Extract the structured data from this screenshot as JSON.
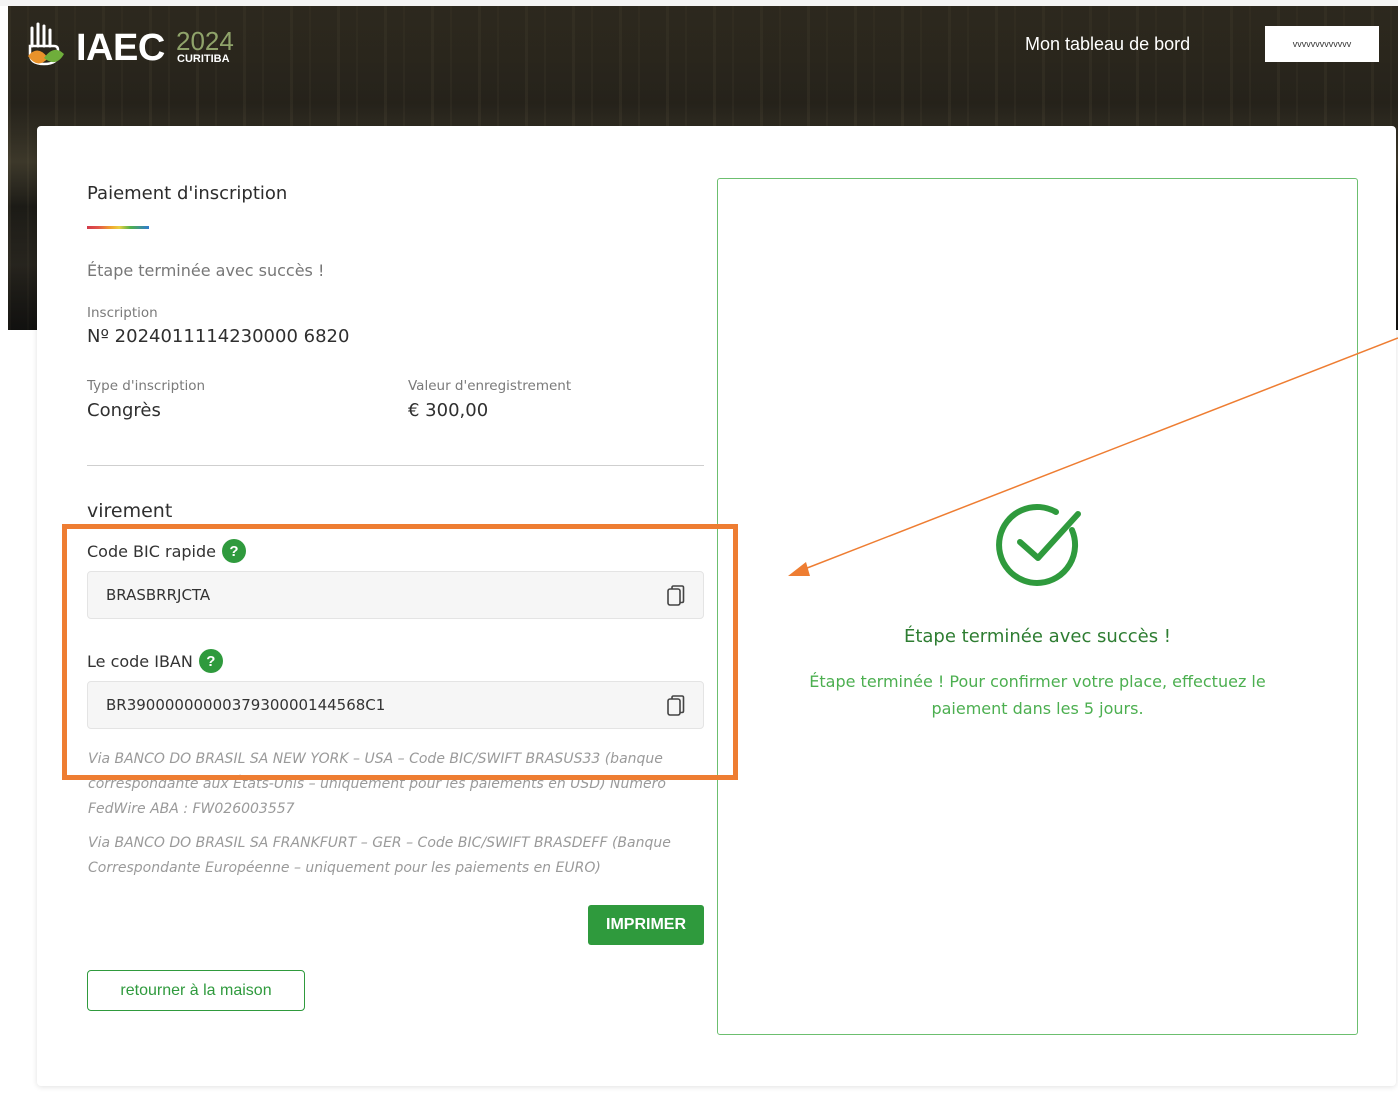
{
  "header": {
    "logo_text": "IAEC",
    "logo_year": "2024",
    "logo_city": "CURITIBA",
    "dashboard_link": "Mon tableau de bord",
    "user_name": "vvvvvvvvvvvvv"
  },
  "payment": {
    "title": "Paiement d'inscription",
    "step_status": "Étape terminée avec succès !",
    "inscription_label": "Inscription",
    "inscription_number": "Nº 2024011114230000 6820",
    "type_label": "Type d'inscription",
    "type_value": "Congrès",
    "value_label": "Valeur d'enregistrement",
    "value_amount": "€ 300,00"
  },
  "transfer": {
    "section_title": "virement",
    "bic_label": "Code BIC rapide",
    "bic_value": "BRASBRRJCTA",
    "iban_label": "Le code IBAN",
    "iban_value": "BR3900000000037930000144568C1",
    "help_icon_glyph": "?",
    "note_usd": "Via BANCO DO BRASIL SA NEW YORK – USA – Code BIC/SWIFT BRASUS33 (banque correspondante aux États-Unis – uniquement pour les paiements en USD) Numéro FedWire ABA : FW026003557",
    "note_euro": "Via BANCO DO BRASIL SA FRANKFURT – GER – Code BIC/SWIFT BRASDEFF (Banque Correspondante Européenne – uniquement pour les paiements en EURO)"
  },
  "actions": {
    "print_label": "IMPRIMER",
    "home_label": "retourner à la maison"
  },
  "success": {
    "title": "Étape terminée avec succès !",
    "message": "Étape terminée ! Pour confirmer votre place, effectuez le paiement dans les 5 jours."
  },
  "colors": {
    "accent_green": "#2f9a3d",
    "success_text": "#4caf50",
    "annotation_orange": "#ee7d32"
  },
  "icons": [
    "logo-hand-leaf-icon",
    "help-icon",
    "copy-icon",
    "check-circle-icon",
    "annotation-arrow"
  ]
}
